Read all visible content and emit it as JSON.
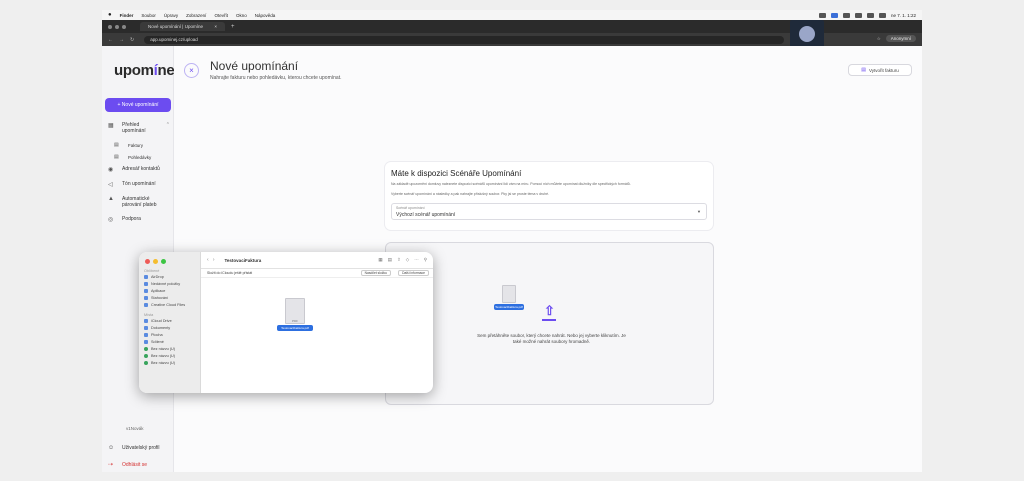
{
  "menubar": {
    "apple": "",
    "items": [
      "Finder",
      "Soubor",
      "Úpravy",
      "Zobrazení",
      "Otevřít",
      "Okno",
      "Nápověda"
    ],
    "clock": "ne 7. 1. 1:22"
  },
  "browser": {
    "tab_title": "Nové upomínání | Upomíne",
    "tab_close": "×",
    "new_tab": "+",
    "url": "app.upominej.cz/upload",
    "profile": "Anonymní"
  },
  "sidebar": {
    "logo_pre": "upom",
    "logo_accent": "í",
    "logo_post": "nej",
    "new_button": "+ Nové upomínání",
    "overview_label": "Přehled upomínání",
    "sub_invoices": "Faktury",
    "sub_claims": "Pohledávky",
    "address_book": "Adresář kontaktů",
    "tone": "Tón upomínání",
    "auto_pairing": "Automatické párování plateb",
    "support": "Podpora",
    "version": "v1Novák",
    "profile": "Uživatelský profil",
    "logout": "Odhlásit se"
  },
  "main": {
    "title": "Nové upomínání",
    "subtitle": "Nahrajte fakturu nebo pohledávku, kterou chcete upomínat.",
    "create_invoice": "Vytvořit fakturu",
    "card": {
      "title": "Máte k dispozici Scénáře Upomínání",
      "desc1": "Na základě upozornění domluvy naleznete dispozici scénářů upomínání lidí vám na míru. Pomocí nich můžete upomínat dlužníky dle specifických formátů.",
      "desc2": "Vyberte scénář upomínání a následky a pak nahrajte příslušný soubor. Pky jsi se proste téma v druhé.",
      "select_label": "Scénář upomínání",
      "select_value": "Výchozí scénář upomínání"
    },
    "drop": {
      "text": "Sem přetáhněte soubor, který chcete nahrát. Nebo jej vyberte kliknutím. Je také možné nahrát soubory hromadně.",
      "dragged_file": "TestovaciFaktura.pdf"
    }
  },
  "finder": {
    "title": "TestovaciFaktura",
    "favorites_label": "Oblíbené",
    "favorites": [
      "AirDrop",
      "Nedávné položky",
      "Aplikace",
      "Stahování",
      "Creative Cloud Files"
    ],
    "places_label": "Místa",
    "places": [
      "iCloud Drive",
      "Dokumenty",
      "Plocha",
      "Sdílené",
      "Bez názvu (U)",
      "Bez názvu (U)",
      "Bez názvu (U)"
    ],
    "info_bar": "Složit do iCloudu ještě přistát",
    "btn_share": "Nasdílet složku",
    "btn_info": "Další informace",
    "file_name": "TestovaciFaktura.pdf",
    "file_ext": "PDF"
  }
}
